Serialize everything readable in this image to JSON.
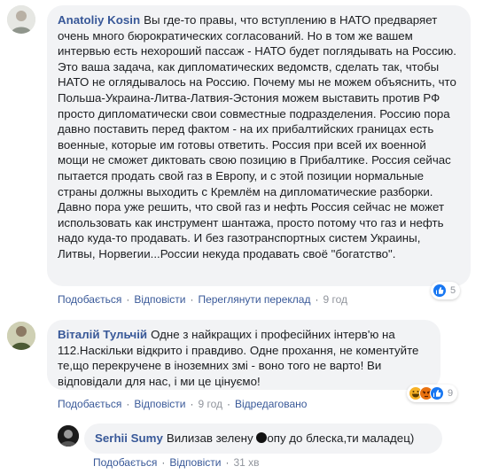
{
  "comments": [
    {
      "author": "Anatoliy Kosin",
      "text": "Вы где-то правы, что вступлению в НАТО предваряет очень много бюрократических согласований. Но в том же вашем интервью есть нехороший пассаж - НАТО будет поглядывать на Россию. Это ваша задача, как дипломатических ведомств, сделать так, чтобы НАТО не оглядывалось на Россию. Почему мы не можем объяснить, что Польша-Украина-Литва-Латвия-Эстония можем выставить против РФ просто дипломатически свои совместные подразделения. Россию пора давно поставить перед фактом - на их прибалтийских границах есть военные, которые им готовы ответить. Россия при всей их военной мощи не сможет диктовать свою позицию в Прибалтике. Россия сейчас пытается продать свой газ в Европу, и с этой позиции нормальные страны должны выходить с Кремлём на дипломатические разборки. Давно пора уже решить, что свой газ и нефть Россия сейчас не может использовать как инструмент шантажа, просто потому что газ и нефть надо куда-то продавать. И без газотранспортных систем Украины, Литвы, Норвегии...России некуда продавать своё \"богатство\".",
      "actions": {
        "like": "Подобається",
        "reply": "Відповісти",
        "translate": "Переглянути переклад",
        "time": "9 год"
      },
      "reactions": {
        "icons": [
          "like-icon"
        ],
        "count": "5"
      }
    },
    {
      "author": "Віталій Тульчій",
      "text": "Одне з найкращих і професійних інтерв'ю на 112.Наскільки відкрито і правдиво. Одне прохання, не коментуйте те,що перекручене в іноземних змі - воно того не варто! Ви відповідали для нас, і ми це цінуємо!",
      "actions": {
        "like": "Подобається",
        "reply": "Відповісти",
        "time": "9 год",
        "edited": "Відредаговано"
      },
      "reactions": {
        "icons": [
          "haha-icon",
          "angry-icon",
          "like-icon"
        ],
        "count": "9"
      }
    },
    {
      "author": "Serhii Sumy",
      "text_before": "Вилизав зелену",
      "text_after": "опу до блеска,ти маладец)",
      "actions": {
        "like": "Подобається",
        "reply": "Відповісти",
        "time": "31 хв"
      }
    }
  ],
  "colors": {
    "link": "#385898",
    "bubble": "#f2f3f5",
    "meta": "#606770",
    "time": "#90949c",
    "like": "#1877f2",
    "haha": "#f7b125",
    "angry": "#e9710f"
  }
}
